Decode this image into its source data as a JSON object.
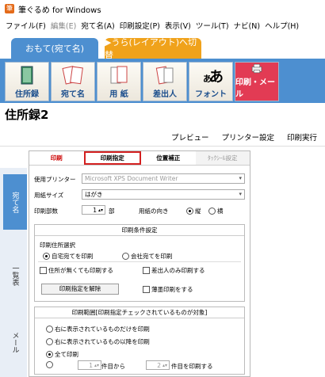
{
  "window": {
    "title": "筆ぐるめ for Windows"
  },
  "menu": [
    "ファイル(F)",
    "編集(E)",
    "宛て名(A)",
    "印刷設定(P)",
    "表示(V)",
    "ツール(T)",
    "ナビ(N)",
    "ヘルプ(H)"
  ],
  "side_tabs": {
    "front": "おもて(宛て名)",
    "back": "▶うら(レイアウト)へ切替"
  },
  "toolbar": [
    "住所録",
    "宛て名",
    "用 紙",
    "差出人",
    "フォント",
    "印刷・メール"
  ],
  "page_title": "住所録2",
  "actions": [
    "プレビュー",
    "プリンター設定",
    "印刷実行"
  ],
  "left_tabs": [
    "宛て名",
    "一覧表",
    "メール"
  ],
  "panel": {
    "tabs": [
      "印刷",
      "印刷指定",
      "位置補正",
      "ﾀｯｸｼｰﾙ設定"
    ],
    "printer_label": "使用プリンター",
    "printer_value": "Microsoft XPS Document Writer",
    "paper_label": "用紙サイズ",
    "paper_value": "はがき",
    "copies_label": "印刷部数",
    "copies_value": "1",
    "copies_unit": "部",
    "orientation_label": "用紙の向き",
    "orientation_portrait": "縦",
    "orientation_landscape": "横",
    "cond_title": "印刷条件設定",
    "addr_select_label": "印刷住所選択",
    "opt_home": "自宅宛てを印刷",
    "opt_company": "会社宛てを印刷",
    "chk_noaddr": "住所が無くても印刷する",
    "chk_senderonly": "差出人のみ印刷する",
    "btn_clear": "印刷指定を解除",
    "chk_thin": "薄墨印刷をする",
    "range_title": "印刷範囲[印刷指定チェックされているものが対象]",
    "range_1": "右に表示されているものだけを印刷",
    "range_2": "右に表示されているもの以降を印刷",
    "range_3": "全て印刷",
    "range_from_value": "1",
    "range_from_suffix": "件目から",
    "range_to_value": "2",
    "range_to_suffix": "件目を印刷する"
  },
  "colors": {
    "accent_blue": "#4d8fd0",
    "orange": "#f0a21b",
    "active_red": "#e23b54",
    "highlight": "#d32020"
  }
}
